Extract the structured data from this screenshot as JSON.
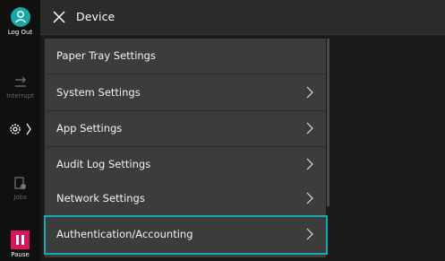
{
  "sidebar": {
    "logout_label": "Log Out",
    "interrupt_label": "Interrupt",
    "jobs_label": "Jobs",
    "pause_label": "Pause"
  },
  "header": {
    "title": "Device"
  },
  "menu": {
    "items": [
      {
        "label": "Paper Tray Settings",
        "has_chevron": false
      },
      {
        "label": "System Settings",
        "has_chevron": true
      },
      {
        "label": "App Settings",
        "has_chevron": true
      },
      {
        "label": "Audit Log Settings",
        "has_chevron": true
      },
      {
        "label": "Network Settings",
        "has_chevron": true
      },
      {
        "label": "Authentication/Accounting",
        "has_chevron": true,
        "selected": true
      }
    ]
  },
  "colors": {
    "accent_teal": "#1aa6a4",
    "selection_border": "#18a9b3",
    "pause_red": "#d8145c"
  }
}
